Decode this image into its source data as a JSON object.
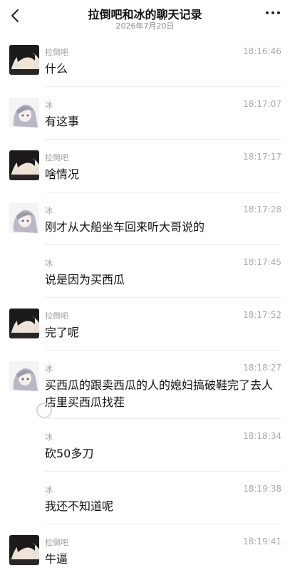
{
  "header": {
    "title": "拉倒吧和冰的聊天记录",
    "date": "2026年7月20日"
  },
  "messages": [
    {
      "sender": "拉倒吧",
      "time": "18:16:46",
      "text": "什么",
      "avatar": "girl-avatar-dark"
    },
    {
      "sender": "冰",
      "time": "18:17:07",
      "text": "有这事",
      "avatar": "anime-avatar"
    },
    {
      "sender": "拉倒吧",
      "time": "18:17:17",
      "text": "啥情况",
      "avatar": "girl-avatar-dark"
    },
    {
      "sender": "冰",
      "time": "18:17:28",
      "text": "刚才从大船坐车回来听大哥说的",
      "avatar": "anime-avatar"
    },
    {
      "sender": "冰",
      "time": "18:17:45",
      "text": "说是因为买西瓜",
      "avatar": ""
    },
    {
      "sender": "拉倒吧",
      "time": "18:17:52",
      "text": "完了呢",
      "avatar": "girl-avatar-dark"
    },
    {
      "sender": "冰",
      "time": "18:18:27",
      "text": "买西瓜的跟卖西瓜的人的媳妇搞破鞋完了去人店里买西瓜找茬",
      "avatar": "anime-avatar"
    },
    {
      "sender": "冰",
      "time": "18:18:34",
      "text": "砍50多刀",
      "avatar": ""
    },
    {
      "sender": "冰",
      "time": "18:19:38",
      "text": "我还不知道呢",
      "avatar": ""
    },
    {
      "sender": "拉倒吧",
      "time": "18:19:41",
      "text": "牛逼",
      "avatar": "girl-avatar-dark"
    }
  ],
  "colors": {
    "background": "#ffffff",
    "name_text": "#9a9a9a",
    "time_text": "#a9a9a9",
    "separator": "#ececec"
  }
}
